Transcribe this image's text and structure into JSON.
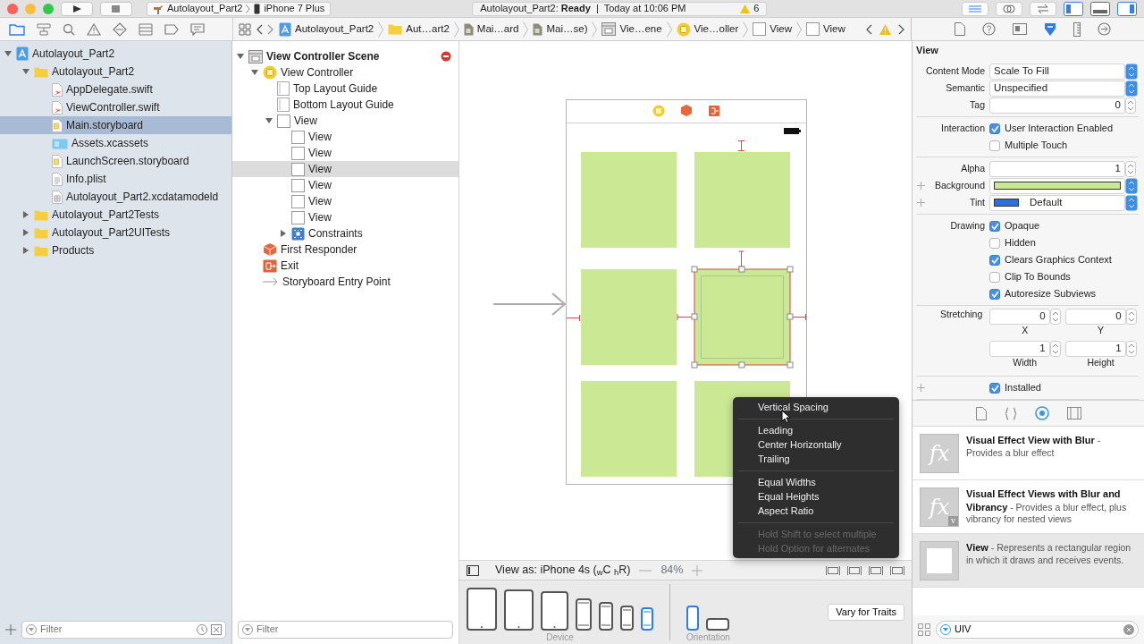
{
  "toolbar": {
    "scheme": "Autolayout_Part2",
    "device": "iPhone 7 Plus",
    "status": "Autolayout_Part2: **Ready**  |  Today at 10:06 PM",
    "warnings": "6"
  },
  "navigator_tabs": [
    {
      "kind": "folder",
      "selected": true
    },
    {
      "kind": "hierarchy",
      "selected": false
    },
    {
      "kind": "search",
      "selected": false
    },
    {
      "kind": "warning",
      "selected": false
    },
    {
      "kind": "diamond",
      "selected": false
    },
    {
      "kind": "list",
      "selected": false
    },
    {
      "kind": "tag",
      "selected": false
    },
    {
      "kind": "bubble",
      "selected": false
    }
  ],
  "jump_bar": [
    {
      "kind": "project",
      "label": "Autolayout_Part2"
    },
    {
      "kind": "folder",
      "label": "Aut…art2"
    },
    {
      "kind": "document",
      "label": "Mai…ard"
    },
    {
      "kind": "document",
      "label": "Mai…se)"
    },
    {
      "kind": "scene",
      "label": "Vie…ene"
    },
    {
      "kind": "vc",
      "label": "Vie…oller"
    },
    {
      "kind": "view",
      "label": "View"
    },
    {
      "kind": "view",
      "label": "View"
    }
  ],
  "inspector_tabs": [
    {
      "kind": "file",
      "selected": false
    },
    {
      "kind": "help",
      "selected": false
    },
    {
      "kind": "identity",
      "selected": false
    },
    {
      "kind": "attributes",
      "selected": true
    },
    {
      "kind": "ruler",
      "selected": false
    },
    {
      "kind": "connections",
      "selected": false
    }
  ],
  "navigator": {
    "filter_placeholder": "Filter",
    "items": [
      {
        "kind": "project",
        "label": "Autolayout_Part2",
        "selected": false,
        "expanded": true,
        "children": [
          {
            "kind": "folder",
            "label": "Autolayout_Part2",
            "selected": false,
            "expanded": true,
            "children": [
              {
                "kind": "swift",
                "label": "AppDelegate.swift",
                "selected": false
              },
              {
                "kind": "swift",
                "label": "ViewController.swift",
                "selected": false
              },
              {
                "kind": "storyboard",
                "label": "Main.storyboard",
                "selected": true
              },
              {
                "kind": "assets",
                "label": "Assets.xcassets",
                "selected": false
              },
              {
                "kind": "storyboard",
                "label": "LaunchScreen.storyboard",
                "selected": false
              },
              {
                "kind": "plist",
                "label": "Info.plist",
                "selected": false
              },
              {
                "kind": "datamodel",
                "label": "Autolayout_Part2.xcdatamodeld",
                "selected": false
              }
            ]
          },
          {
            "kind": "folder",
            "label": "Autolayout_Part2Tests",
            "selected": false,
            "expanded": false
          },
          {
            "kind": "folder",
            "label": "Autolayout_Part2UITests",
            "selected": false,
            "expanded": false
          },
          {
            "kind": "folder",
            "label": "Products",
            "selected": false,
            "expanded": false
          }
        ]
      }
    ]
  },
  "outline": {
    "filter_placeholder": "Filter",
    "items": [
      {
        "kind": "scene",
        "label": "View Controller Scene",
        "selected": false,
        "expanded": true,
        "has_error": true,
        "children": [
          {
            "kind": "vc",
            "label": "View Controller",
            "selected": false,
            "expanded": true,
            "children": [
              {
                "kind": "guide",
                "label": "Top Layout Guide",
                "selected": false
              },
              {
                "kind": "guide",
                "label": "Bottom Layout Guide",
                "selected": false
              },
              {
                "kind": "view",
                "label": "View",
                "selected": false,
                "expanded": true,
                "children": [
                  {
                    "kind": "view",
                    "label": "View",
                    "selected": false
                  },
                  {
                    "kind": "view",
                    "label": "View",
                    "selected": false
                  },
                  {
                    "kind": "view",
                    "label": "View",
                    "selected": true
                  },
                  {
                    "kind": "view",
                    "label": "View",
                    "selected": false
                  },
                  {
                    "kind": "view",
                    "label": "View",
                    "selected": false
                  },
                  {
                    "kind": "view",
                    "label": "View",
                    "selected": false
                  },
                  {
                    "kind": "constraints",
                    "label": "Constraints",
                    "selected": false,
                    "expanded": false
                  }
                ]
              }
            ]
          },
          {
            "kind": "responder",
            "label": "First Responder",
            "selected": false
          },
          {
            "kind": "exit",
            "label": "Exit",
            "selected": false
          },
          {
            "kind": "entry",
            "label": "Storyboard Entry Point",
            "selected": false
          }
        ]
      }
    ]
  },
  "canvas": {
    "views": [
      {
        "selected": false
      },
      {
        "selected": false
      },
      {
        "selected": false
      },
      {
        "selected": true
      },
      {
        "selected": false
      },
      {
        "selected": false
      }
    ],
    "context_menu": [
      [
        {
          "label": "Vertical Spacing",
          "disabled": false
        }
      ],
      [
        {
          "label": "Leading",
          "disabled": false
        },
        {
          "label": "Center Horizontally",
          "disabled": false
        },
        {
          "label": "Trailing",
          "disabled": false
        }
      ],
      [
        {
          "label": "Equal Widths",
          "disabled": false
        },
        {
          "label": "Equal Heights",
          "disabled": false
        },
        {
          "label": "Aspect Ratio",
          "disabled": false
        }
      ],
      [
        {
          "label": "Hold Shift to select multiple",
          "disabled": true
        },
        {
          "label": "Hold Option for alternates",
          "disabled": true
        }
      ]
    ],
    "view_as": "View as: iPhone 4s ($_{w}$C $_{h}$R)",
    "zoom": "84%"
  },
  "device_bar": {
    "devices": [
      {
        "kind": "tablet",
        "selected": false
      },
      {
        "kind": "tablet",
        "selected": false
      },
      {
        "kind": "tablet",
        "selected": false
      },
      {
        "kind": "phone",
        "selected": false
      },
      {
        "kind": "phone",
        "selected": false
      },
      {
        "kind": "phone",
        "selected": false
      },
      {
        "kind": "phone",
        "selected": true
      }
    ],
    "device_label": "Device",
    "orientations": [
      {
        "kind": "portrait",
        "selected": true
      },
      {
        "kind": "landscape",
        "selected": false
      }
    ],
    "orientation_label": "Orientation",
    "vary_button": "Vary for Traits"
  },
  "inspector": {
    "title": "View",
    "groups": [
      [
        {
          "kind": "select",
          "label": "Content Mode",
          "value": "Scale To Fill"
        },
        {
          "kind": "select",
          "label": "Semantic",
          "value": "Unspecified"
        },
        {
          "kind": "stepper",
          "label": "Tag",
          "value": "0"
        }
      ],
      [
        {
          "kind": "checkbox",
          "label": "Interaction",
          "text": "User Interaction Enabled",
          "checked": true
        },
        {
          "kind": "checkbox",
          "text": "Multiple Touch",
          "checked": false
        }
      ],
      [
        {
          "kind": "stepper",
          "label": "Alpha",
          "value": "1"
        },
        {
          "kind": "color",
          "label": "Background",
          "color": "#c8e896",
          "plus": true
        },
        {
          "kind": "color_select",
          "label": "Tint",
          "color": "#2f6fd6",
          "value": "Default",
          "plus": true
        }
      ],
      [
        {
          "kind": "checkbox",
          "label": "Drawing",
          "text": "Opaque",
          "checked": true
        },
        {
          "kind": "checkbox",
          "text": "Hidden",
          "checked": false
        },
        {
          "kind": "checkbox",
          "text": "Clears Graphics Context",
          "checked": true
        },
        {
          "kind": "checkbox",
          "text": "Clip To Bounds",
          "checked": false
        },
        {
          "kind": "checkbox",
          "text": "Autoresize Subviews",
          "checked": true
        }
      ],
      [
        {
          "kind": "pair",
          "label": "Stretching",
          "fields": [
            {
              "value": "0",
              "caption": "X"
            },
            {
              "value": "0",
              "caption": "Y"
            }
          ]
        },
        {
          "kind": "pair",
          "fields": [
            {
              "value": "1",
              "caption": "Width"
            },
            {
              "value": "1",
              "caption": "Height"
            }
          ]
        }
      ],
      [
        {
          "kind": "checkbox",
          "text": "Installed",
          "checked": true,
          "plus": true
        }
      ]
    ]
  },
  "library": {
    "tabs": [
      {
        "kind": "file",
        "selected": false
      },
      {
        "kind": "braces",
        "selected": false
      },
      {
        "kind": "object",
        "selected": true
      },
      {
        "kind": "media",
        "selected": false
      }
    ],
    "items": [
      {
        "kind": "effect",
        "icon_text": "fx",
        "text": "**Visual Effect View with Blur** - Provides a blur effect",
        "selected": false
      },
      {
        "kind": "effect",
        "icon_text": "fx",
        "badge": "v",
        "text": "**Visual Effect Views with Blur and Vibrancy** - Provides a blur effect, plus vibrancy for nested views",
        "selected": false
      },
      {
        "kind": "view",
        "text": "**View** - Represents a rectangular region in which it draws and receives events.",
        "selected": true
      }
    ],
    "search": "UIV"
  }
}
